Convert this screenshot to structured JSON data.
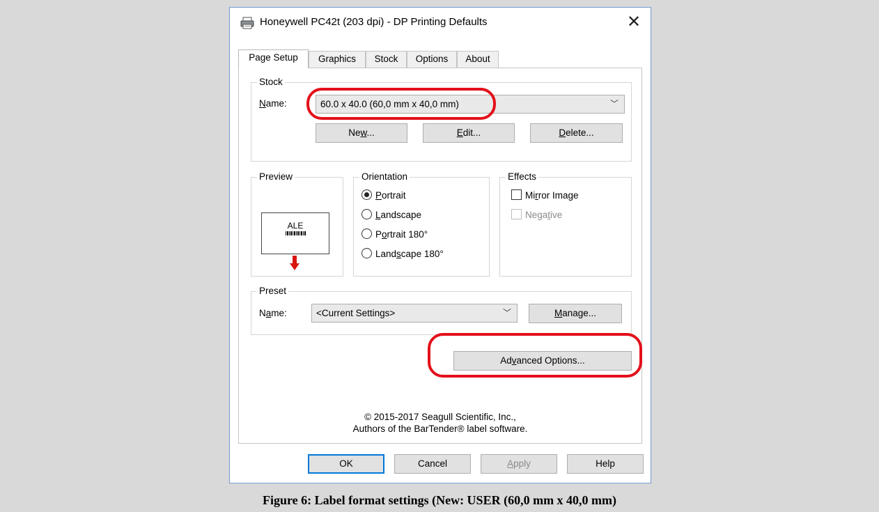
{
  "window": {
    "title": "Honeywell PC42t (203 dpi) - DP Printing Defaults",
    "close_glyph": "✕",
    "icon": "printer-icon"
  },
  "tabs": [
    {
      "label": "Page Setup",
      "active": true
    },
    {
      "label": "Graphics",
      "active": false
    },
    {
      "label": "Stock",
      "active": false
    },
    {
      "label": "Options",
      "active": false
    },
    {
      "label": "About",
      "active": false
    }
  ],
  "stock": {
    "group_label": "Stock",
    "name_label": "Name:",
    "name_value": "60.0 x 40.0 (60,0 mm x 40,0 mm)",
    "new_button": "New...",
    "edit_button": "Edit...",
    "delete_button": "Delete..."
  },
  "preview": {
    "group_label": "Preview",
    "label_text": "ALE"
  },
  "orientation": {
    "group_label": "Orientation",
    "options": [
      {
        "label": "Portrait",
        "checked": true
      },
      {
        "label": "Landscape",
        "checked": false
      },
      {
        "label": "Portrait 180°",
        "checked": false
      },
      {
        "label": "Landscape 180°",
        "checked": false
      }
    ]
  },
  "effects": {
    "group_label": "Effects",
    "mirror_image": "Mirror Image",
    "negative": "Negative"
  },
  "preset": {
    "group_label": "Preset",
    "name_label": "Name:",
    "name_value": "<Current Settings>",
    "manage_button": "Manage..."
  },
  "advanced_button": "Advanced Options...",
  "copyright": {
    "line1": "© 2015-2017 Seagull Scientific, Inc.,",
    "line2": "Authors of the BarTender® label software."
  },
  "footer_buttons": {
    "ok": "OK",
    "cancel": "Cancel",
    "apply": "Apply",
    "help": "Help"
  },
  "caption": "Figure 6: Label format settings (New: USER (60,0 mm x 40,0 mm)",
  "colors": {
    "annotation": "#e3101a",
    "accent": "#0078d7",
    "dialog_border": "#6f9bd1",
    "arrow": "#d9140f"
  }
}
